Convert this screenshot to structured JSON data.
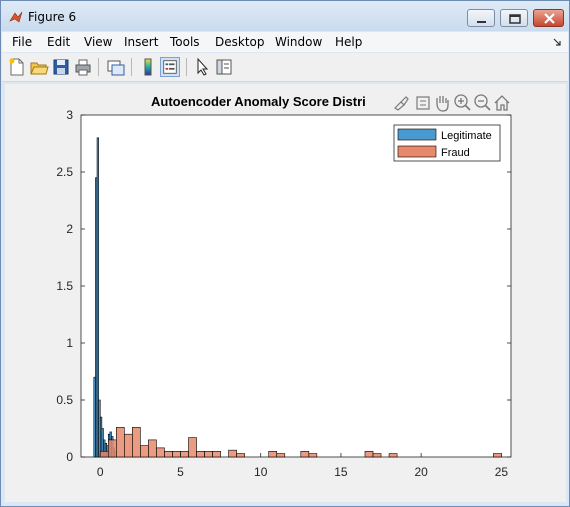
{
  "window": {
    "title": "Figure 6"
  },
  "menu": {
    "items": [
      "File",
      "Edit",
      "View",
      "Insert",
      "Tools",
      "Desktop",
      "Window",
      "Help"
    ]
  },
  "toolbar": {
    "icons": [
      "new-figure-icon",
      "open-file-icon",
      "save-icon",
      "print-icon",
      "link-plot-icon",
      "insert-colorbar-icon",
      "insert-legend-icon",
      "edit-plot-icon",
      "property-inspector-icon"
    ]
  },
  "axes_toolbar": {
    "icons": [
      "brush-icon",
      "data-tips-icon",
      "pan-icon",
      "zoom-in-icon",
      "zoom-out-icon",
      "home-icon"
    ]
  },
  "colors": {
    "legitimate": "#4a9ad2",
    "fraud": "#e8896b"
  },
  "chart_data": {
    "type": "histogram",
    "title": "Autoencoder Anomaly Score Distri",
    "xlim": [
      -1.2,
      25.6
    ],
    "ylim": [
      0,
      3
    ],
    "xticks": [
      0,
      5,
      10,
      15,
      20,
      25
    ],
    "yticks": [
      0,
      0.5,
      1,
      1.5,
      2,
      2.5,
      3
    ],
    "xtick_labels": [
      "0",
      "5",
      "10",
      "15",
      "20",
      "25"
    ],
    "ytick_labels": [
      "0",
      "0.5",
      "1",
      "1.5",
      "2",
      "2.5",
      "3"
    ],
    "legend_placement": "top-right",
    "series": [
      {
        "name": "Legitimate",
        "bin_width": 0.1,
        "bins": [
          {
            "x": -0.4,
            "y": 0.7
          },
          {
            "x": -0.3,
            "y": 2.45
          },
          {
            "x": -0.2,
            "y": 2.8
          },
          {
            "x": -0.1,
            "y": 0.5
          },
          {
            "x": 0.0,
            "y": 0.35
          },
          {
            "x": 0.1,
            "y": 0.25
          },
          {
            "x": 0.2,
            "y": 0.15
          },
          {
            "x": 0.3,
            "y": 0.12
          },
          {
            "x": 0.4,
            "y": 0.1
          },
          {
            "x": 0.5,
            "y": 0.2
          },
          {
            "x": 0.6,
            "y": 0.22
          },
          {
            "x": 0.7,
            "y": 0.18
          },
          {
            "x": 0.8,
            "y": 0.08
          },
          {
            "x": 0.9,
            "y": 0.05
          }
        ]
      },
      {
        "name": "Fraud",
        "bin_width": 0.5,
        "bins": [
          {
            "x": 0.0,
            "y": 0.05
          },
          {
            "x": 0.5,
            "y": 0.15
          },
          {
            "x": 1.0,
            "y": 0.26
          },
          {
            "x": 1.5,
            "y": 0.2
          },
          {
            "x": 2.0,
            "y": 0.26
          },
          {
            "x": 2.5,
            "y": 0.1
          },
          {
            "x": 3.0,
            "y": 0.15
          },
          {
            "x": 3.5,
            "y": 0.08
          },
          {
            "x": 4.0,
            "y": 0.05
          },
          {
            "x": 4.5,
            "y": 0.05
          },
          {
            "x": 5.0,
            "y": 0.05
          },
          {
            "x": 5.5,
            "y": 0.17
          },
          {
            "x": 6.0,
            "y": 0.05
          },
          {
            "x": 6.5,
            "y": 0.05
          },
          {
            "x": 7.0,
            "y": 0.05
          },
          {
            "x": 8.0,
            "y": 0.06
          },
          {
            "x": 8.5,
            "y": 0.03
          },
          {
            "x": 10.5,
            "y": 0.05
          },
          {
            "x": 11.0,
            "y": 0.03
          },
          {
            "x": 12.5,
            "y": 0.05
          },
          {
            "x": 13.0,
            "y": 0.03
          },
          {
            "x": 16.5,
            "y": 0.05
          },
          {
            "x": 17.0,
            "y": 0.03
          },
          {
            "x": 18.0,
            "y": 0.03
          },
          {
            "x": 24.5,
            "y": 0.03
          }
        ]
      }
    ]
  }
}
